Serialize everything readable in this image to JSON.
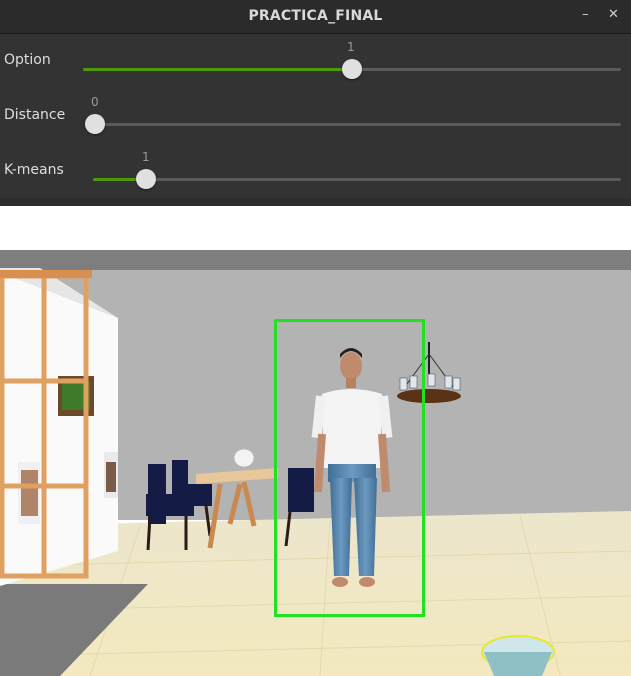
{
  "window": {
    "title": "PRACTICA_FINAL",
    "minimize_glyph": "–",
    "close_glyph": "✕"
  },
  "sliders": [
    {
      "label": "Option",
      "value": "1",
      "fraction": 0.5
    },
    {
      "label": "Distance",
      "value": "0",
      "fraction": 0.0
    },
    {
      "label": "K-means",
      "value": "1",
      "fraction": 0.1
    }
  ],
  "scene": {
    "description_icon": "3d-scene",
    "detection_box_color": "#22e022"
  }
}
